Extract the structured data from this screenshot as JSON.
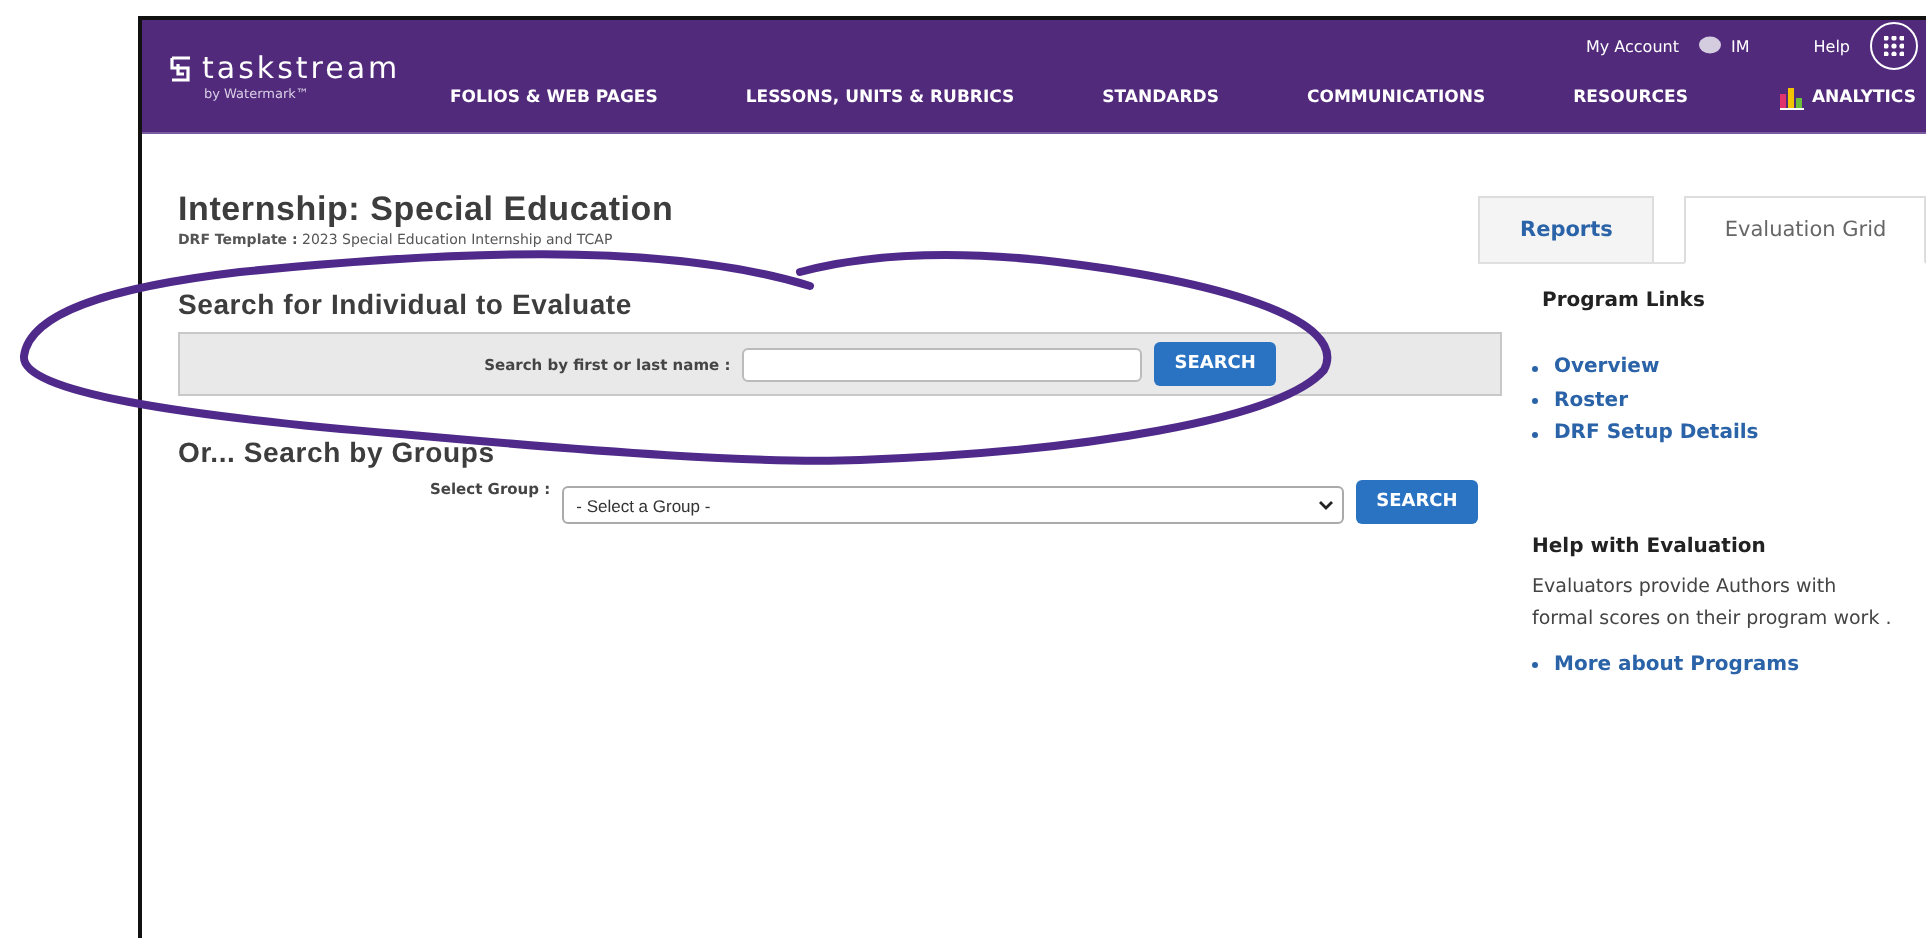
{
  "header": {
    "logo": {
      "name": "taskstream",
      "tagline": "by Watermark™"
    },
    "utility": {
      "account": "My Account",
      "initials": "IM",
      "help": "Help"
    },
    "nav": [
      {
        "label": "FOLIOS & WEB PAGES",
        "kind": "text"
      },
      {
        "label": "LESSONS, UNITS & RUBRICS",
        "kind": "text"
      },
      {
        "label": "STANDARDS",
        "kind": "text"
      },
      {
        "label": "COMMUNICATIONS",
        "kind": "text"
      },
      {
        "label": "RESOURCES",
        "kind": "text"
      },
      {
        "label": "ANALYTICS",
        "kind": "chart"
      }
    ]
  },
  "page": {
    "title": "Internship: Special Education",
    "subtitle": "**DRF Template :** 2023 Special Education Internship and TCAP"
  },
  "tabs": [
    {
      "label": "Reports",
      "selected": false
    },
    {
      "label": "Evaluation Grid",
      "selected": true
    }
  ],
  "individual_search": {
    "heading": "Search for Individual to Evaluate",
    "label": "Search by first or last name :",
    "button": "SEARCH"
  },
  "group_search": {
    "heading": "Or... Search by Groups",
    "label": "Select Group :",
    "select_value": "- Select a Group -",
    "button": "SEARCH"
  },
  "sidebar": {
    "program_links": {
      "heading": "Program Links",
      "links": [
        "Overview",
        "Roster",
        "DRF Setup Details"
      ]
    },
    "help": {
      "heading": "Help with Evaluation",
      "text": "Evaluators provide Authors with formal scores on their program work .",
      "links": [
        "More about Programs"
      ]
    }
  }
}
